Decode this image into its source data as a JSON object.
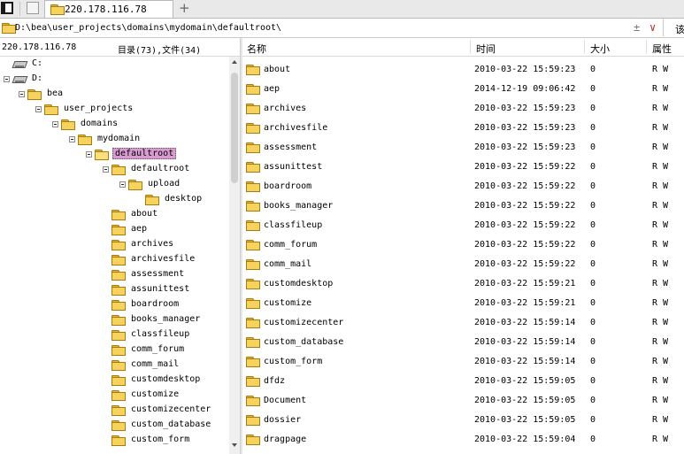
{
  "tab": {
    "title": "220.178.116.78"
  },
  "address": {
    "path": "D:\\bea\\user_projects\\domains\\mydomain\\defaultroot\\",
    "split_glyph": "±",
    "dropdown_glyph": "∨",
    "go_label": "该"
  },
  "left_pane": {
    "host": "220.178.116.78",
    "summary": "目录(73),文件(34)",
    "tree": [
      {
        "label": "C:",
        "kind": "drive",
        "depth": 0,
        "expander": false
      },
      {
        "label": "D:",
        "kind": "drive",
        "depth": 0,
        "expander": true
      },
      {
        "label": "bea",
        "kind": "folder",
        "depth": 1,
        "expander": true
      },
      {
        "label": "user_projects",
        "kind": "folder",
        "depth": 2,
        "expander": true
      },
      {
        "label": "domains",
        "kind": "folder",
        "depth": 3,
        "expander": true
      },
      {
        "label": "mydomain",
        "kind": "folder",
        "depth": 4,
        "expander": true
      },
      {
        "label": "defaultroot",
        "kind": "folder",
        "depth": 5,
        "expander": true,
        "selected": true
      },
      {
        "label": "defaultroot",
        "kind": "folder",
        "depth": 6,
        "expander": true
      },
      {
        "label": "upload",
        "kind": "folder",
        "depth": 7,
        "expander": true
      },
      {
        "label": "desktop",
        "kind": "folder",
        "depth": 8,
        "expander": false
      },
      {
        "label": "about",
        "kind": "folder",
        "depth": 6,
        "expander": false
      },
      {
        "label": "aep",
        "kind": "folder",
        "depth": 6,
        "expander": false
      },
      {
        "label": "archives",
        "kind": "folder",
        "depth": 6,
        "expander": false
      },
      {
        "label": "archivesfile",
        "kind": "folder",
        "depth": 6,
        "expander": false
      },
      {
        "label": "assessment",
        "kind": "folder",
        "depth": 6,
        "expander": false
      },
      {
        "label": "assunittest",
        "kind": "folder",
        "depth": 6,
        "expander": false
      },
      {
        "label": "boardroom",
        "kind": "folder",
        "depth": 6,
        "expander": false
      },
      {
        "label": "books_manager",
        "kind": "folder",
        "depth": 6,
        "expander": false
      },
      {
        "label": "classfileup",
        "kind": "folder",
        "depth": 6,
        "expander": false
      },
      {
        "label": "comm_forum",
        "kind": "folder",
        "depth": 6,
        "expander": false
      },
      {
        "label": "comm_mail",
        "kind": "folder",
        "depth": 6,
        "expander": false
      },
      {
        "label": "customdesktop",
        "kind": "folder",
        "depth": 6,
        "expander": false
      },
      {
        "label": "customize",
        "kind": "folder",
        "depth": 6,
        "expander": false
      },
      {
        "label": "customizecenter",
        "kind": "folder",
        "depth": 6,
        "expander": false
      },
      {
        "label": "custom_database",
        "kind": "folder",
        "depth": 6,
        "expander": false
      },
      {
        "label": "custom_form",
        "kind": "folder",
        "depth": 6,
        "expander": false
      }
    ]
  },
  "columns": {
    "name": "名称",
    "time": "时间",
    "size": "大小",
    "attr": "属性"
  },
  "files": [
    {
      "name": "about",
      "time": "2010-03-22 15:59:23",
      "size": "0",
      "attr": "R W"
    },
    {
      "name": "aep",
      "time": "2014-12-19 09:06:42",
      "size": "0",
      "attr": "R W"
    },
    {
      "name": "archives",
      "time": "2010-03-22 15:59:23",
      "size": "0",
      "attr": "R W"
    },
    {
      "name": "archivesfile",
      "time": "2010-03-22 15:59:23",
      "size": "0",
      "attr": "R W"
    },
    {
      "name": "assessment",
      "time": "2010-03-22 15:59:23",
      "size": "0",
      "attr": "R W"
    },
    {
      "name": "assunittest",
      "time": "2010-03-22 15:59:22",
      "size": "0",
      "attr": "R W"
    },
    {
      "name": "boardroom",
      "time": "2010-03-22 15:59:22",
      "size": "0",
      "attr": "R W"
    },
    {
      "name": "books_manager",
      "time": "2010-03-22 15:59:22",
      "size": "0",
      "attr": "R W"
    },
    {
      "name": "classfileup",
      "time": "2010-03-22 15:59:22",
      "size": "0",
      "attr": "R W"
    },
    {
      "name": "comm_forum",
      "time": "2010-03-22 15:59:22",
      "size": "0",
      "attr": "R W"
    },
    {
      "name": "comm_mail",
      "time": "2010-03-22 15:59:22",
      "size": "0",
      "attr": "R W"
    },
    {
      "name": "customdesktop",
      "time": "2010-03-22 15:59:21",
      "size": "0",
      "attr": "R W"
    },
    {
      "name": "customize",
      "time": "2010-03-22 15:59:21",
      "size": "0",
      "attr": "R W"
    },
    {
      "name": "customizecenter",
      "time": "2010-03-22 15:59:14",
      "size": "0",
      "attr": "R W"
    },
    {
      "name": "custom_database",
      "time": "2010-03-22 15:59:14",
      "size": "0",
      "attr": "R W"
    },
    {
      "name": "custom_form",
      "time": "2010-03-22 15:59:14",
      "size": "0",
      "attr": "R W"
    },
    {
      "name": "dfdz",
      "time": "2010-03-22 15:59:05",
      "size": "0",
      "attr": "R W"
    },
    {
      "name": "Document",
      "time": "2010-03-22 15:59:05",
      "size": "0",
      "attr": "R W"
    },
    {
      "name": "dossier",
      "time": "2010-03-22 15:59:05",
      "size": "0",
      "attr": "R W"
    },
    {
      "name": "dragpage",
      "time": "2010-03-22 15:59:04",
      "size": "0",
      "attr": "R W"
    }
  ],
  "colors": {
    "selection": "#d99bd1",
    "folder": "#f6d35c"
  }
}
